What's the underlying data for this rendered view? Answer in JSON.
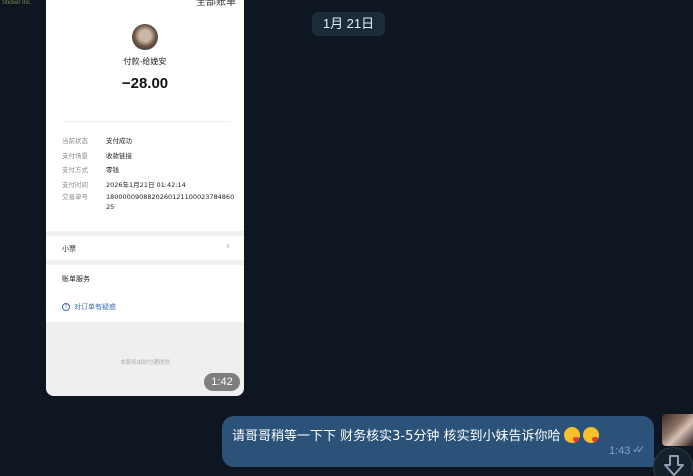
{
  "corner_label": "Sticker Inc.",
  "date_separator": "1月 21日",
  "payment_screenshot": {
    "top_right": "全部账单",
    "payee": "付款-给娩安",
    "amount": "−28.00",
    "details": [
      {
        "key": "当前状态",
        "value": "支付成功"
      },
      {
        "key": "支付场景",
        "value": "收款链接"
      },
      {
        "key": "支付方式",
        "value": "零钱"
      },
      {
        "key": "支付时间",
        "value": "2026年1月21日 01:42:14"
      },
      {
        "key": "交易单号",
        "value": "180000090882026012110002378486025"
      }
    ],
    "ticket_label": "小票",
    "bill_service": "账单服务",
    "question_link": "对订单有疑惑",
    "footer_note": "本服务由财付通提供",
    "time": "1:42"
  },
  "outgoing_message": {
    "text": "请哥哥稍等一下下 财务核实3-5分钟 核实到小妹告诉你哈",
    "emojis": [
      "kiss-emoji",
      "kiss-emoji"
    ],
    "time": "1:43",
    "status": "read"
  }
}
